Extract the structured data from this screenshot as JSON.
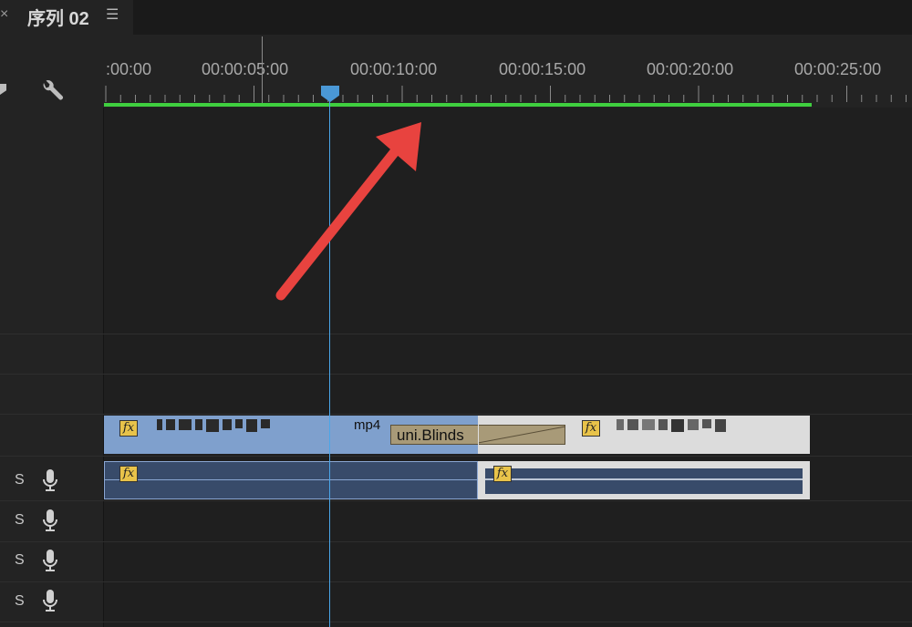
{
  "tab": {
    "close_icon": "×",
    "title": "序列 02",
    "menu_icon": "☰"
  },
  "toolbar": {
    "wrench_icon": "wrench-icon"
  },
  "ruler": {
    "timecodes": [
      ":00:00",
      "00:00:05:00",
      "00:00:10:00",
      "00:00:15:00",
      "00:00:20:00",
      "00:00:25:00"
    ],
    "work_area_color": "#3fcf3f"
  },
  "clips": {
    "video_clip_1_name": "mp4",
    "transition_label": "uni.Blinds",
    "fx_label": "fx"
  },
  "audio_tracks": [
    {
      "solo": "S",
      "icon": "microphone-icon"
    },
    {
      "solo": "S",
      "icon": "microphone-icon"
    },
    {
      "solo": "S",
      "icon": "microphone-icon"
    },
    {
      "solo": "S",
      "icon": "microphone-icon"
    }
  ],
  "colors": {
    "playhead": "#4aa6e8",
    "video_clip": "#7fa0cd",
    "selected_clip": "#dcdcdc",
    "annotation_arrow": "#e8433f"
  }
}
